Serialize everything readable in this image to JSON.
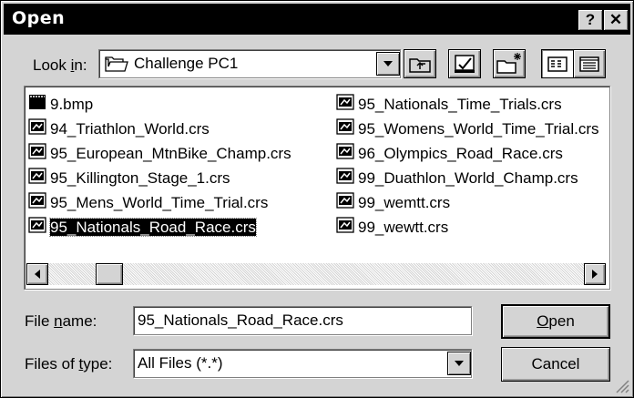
{
  "window": {
    "title": "Open",
    "help_glyph": "?",
    "close_glyph": "✕"
  },
  "lookin": {
    "label_pre": "Look ",
    "label_key": "i",
    "label_post": "n:",
    "value": "Challenge PC1",
    "icon": "folder-icon"
  },
  "toolbar": {
    "icons": [
      "up-one-level-icon",
      "desktop-icon",
      "new-folder-icon",
      "list-view-icon",
      "details-view-icon"
    ]
  },
  "files": {
    "column1": [
      {
        "name": "9.bmp",
        "icon": "bitmap-icon"
      },
      {
        "name": "94_Triathlon_World.crs",
        "icon": "course-file-icon"
      },
      {
        "name": "95_European_MtnBike_Champ.crs",
        "icon": "course-file-icon"
      },
      {
        "name": "95_Killington_Stage_1.crs",
        "icon": "course-file-icon"
      },
      {
        "name": "95_Mens_World_Time_Trial.crs",
        "icon": "course-file-icon"
      },
      {
        "name": "95_Nationals_Road_Race.crs",
        "icon": "course-file-icon",
        "selected": true
      }
    ],
    "column2": [
      {
        "name": "95_Nationals_Time_Trials.crs",
        "icon": "course-file-icon"
      },
      {
        "name": "95_Womens_World_Time_Trial.crs",
        "icon": "course-file-icon"
      },
      {
        "name": "96_Olympics_Road_Race.crs",
        "icon": "course-file-icon"
      },
      {
        "name": "99_Duathlon_World_Champ.crs",
        "icon": "course-file-icon"
      },
      {
        "name": "99_wemtt.crs",
        "icon": "course-file-icon"
      },
      {
        "name": "99_wewtt.crs",
        "icon": "course-file-icon"
      }
    ]
  },
  "filename": {
    "label_pre": "File ",
    "label_key": "n",
    "label_post": "ame:",
    "value": "95_Nationals_Road_Race.crs"
  },
  "filetype": {
    "label_pre": "Files of ",
    "label_key": "t",
    "label_post": "ype:",
    "value": "All Files (*.*)"
  },
  "buttons": {
    "open_key": "O",
    "open_rest": "pen",
    "cancel": "Cancel"
  }
}
